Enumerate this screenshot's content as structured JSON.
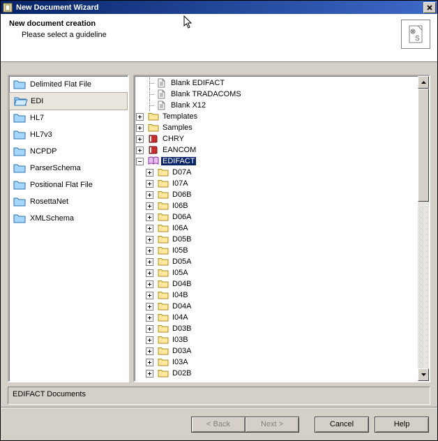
{
  "titlebar": {
    "title": "New Document Wizard"
  },
  "header": {
    "title": "New document creation",
    "subtitle": "Please select a guideline"
  },
  "categories": [
    {
      "label": "Delimited Flat File",
      "selected": false
    },
    {
      "label": "EDI",
      "selected": true
    },
    {
      "label": "HL7",
      "selected": false
    },
    {
      "label": "HL7v3",
      "selected": false
    },
    {
      "label": "NCPDP",
      "selected": false
    },
    {
      "label": "ParserSchema",
      "selected": false
    },
    {
      "label": "Positional Flat File",
      "selected": false
    },
    {
      "label": "RosettaNet",
      "selected": false
    },
    {
      "label": "XMLSchema",
      "selected": false
    }
  ],
  "tree": {
    "roots": [
      {
        "label": "Blank EDIFACT",
        "expander": "none",
        "icon": "doc",
        "depth": 1
      },
      {
        "label": "Blank TRADACOMS",
        "expander": "none",
        "icon": "doc",
        "depth": 1
      },
      {
        "label": "Blank X12",
        "expander": "none",
        "icon": "doc",
        "depth": 1
      },
      {
        "label": "Templates",
        "expander": "plus",
        "icon": "folder",
        "depth": 0
      },
      {
        "label": "Samples",
        "expander": "plus",
        "icon": "folder",
        "depth": 0
      },
      {
        "label": "CHRY",
        "expander": "plus",
        "icon": "book",
        "depth": 0
      },
      {
        "label": "EANCOM",
        "expander": "plus",
        "icon": "book",
        "depth": 0
      },
      {
        "label": "EDIFACT",
        "expander": "minus",
        "icon": "openbook",
        "depth": 0,
        "selected": true
      }
    ],
    "edifact_children": [
      "D07A",
      "I07A",
      "D06B",
      "I06B",
      "D06A",
      "I06A",
      "D05B",
      "I05B",
      "D05A",
      "I05A",
      "D04B",
      "I04B",
      "D04A",
      "I04A",
      "D03B",
      "I03B",
      "D03A",
      "I03A",
      "D02B"
    ]
  },
  "status": {
    "text": "EDIFACT Documents"
  },
  "buttons": {
    "back": "< Back",
    "next": "Next >",
    "cancel": "Cancel",
    "help": "Help"
  }
}
